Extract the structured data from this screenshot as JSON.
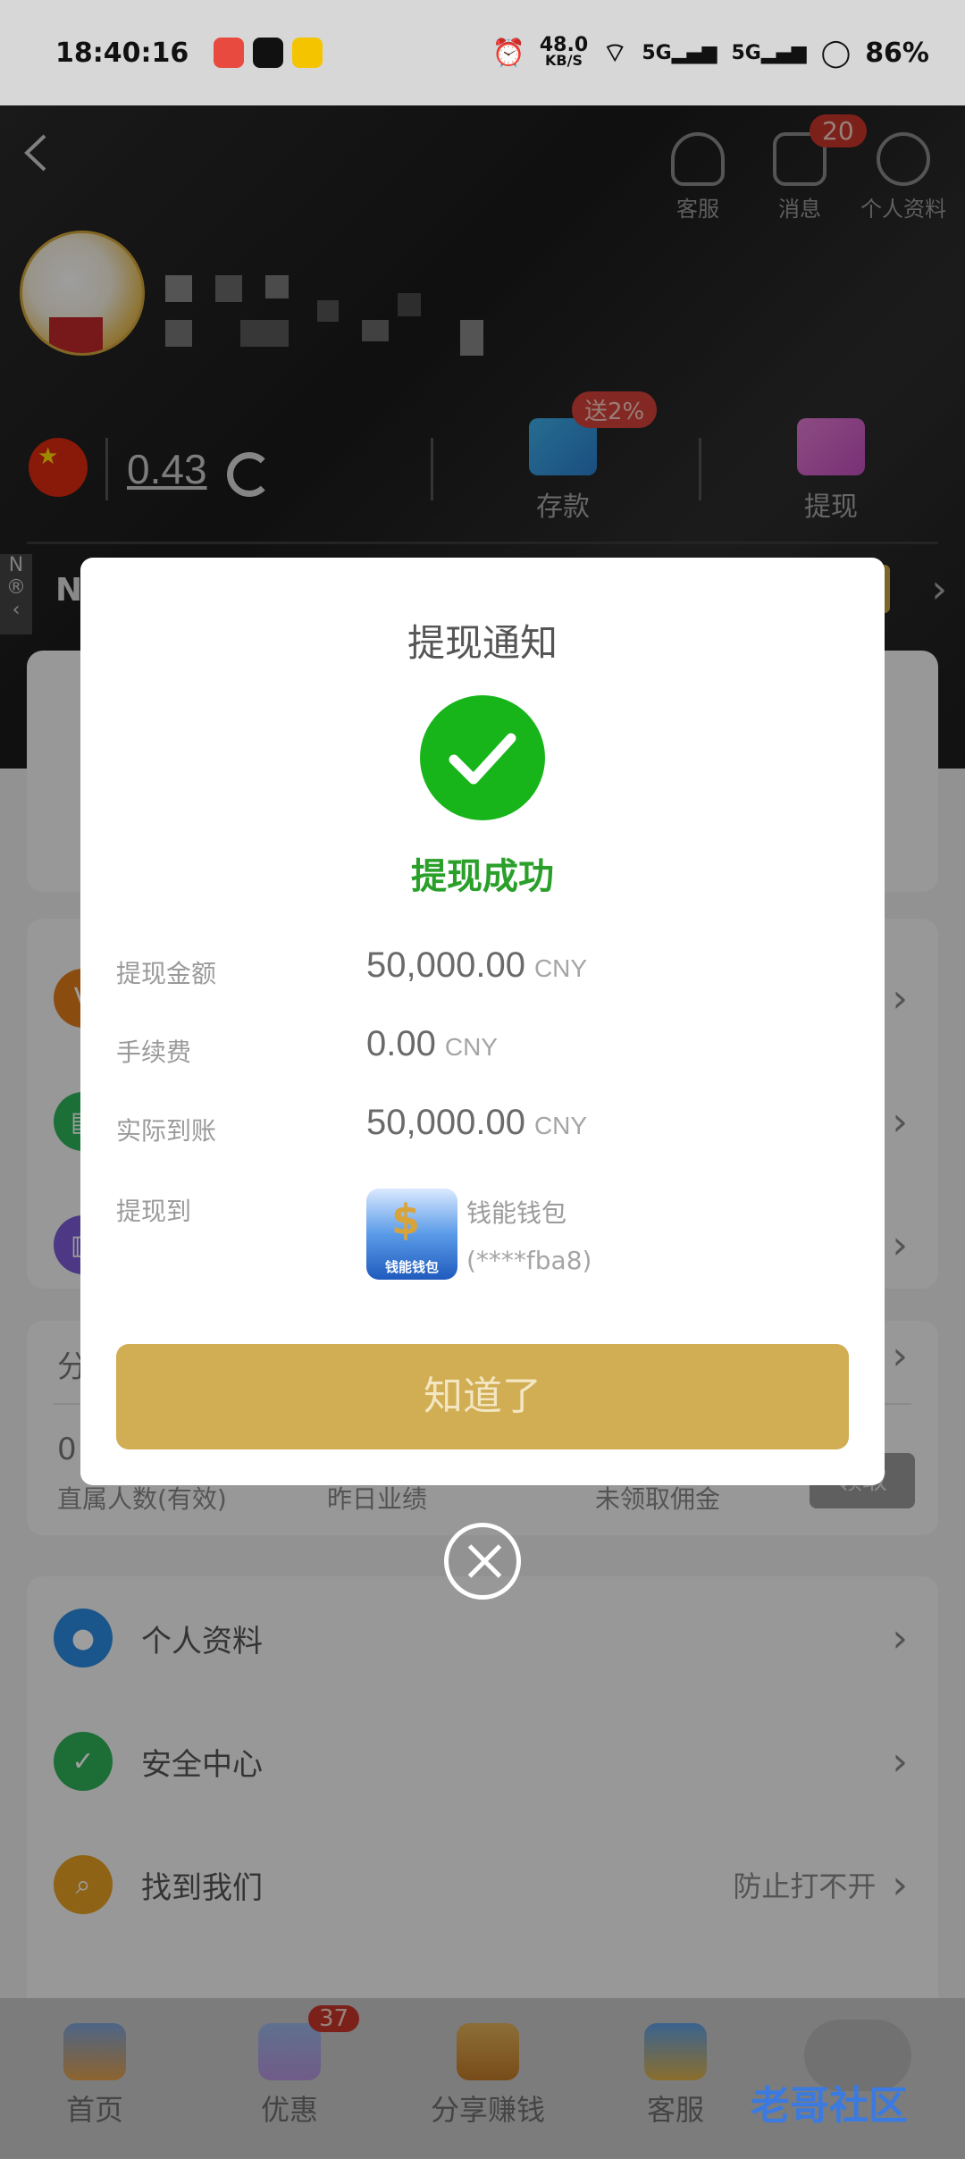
{
  "status_bar": {
    "time": "18:40:16",
    "net_speed": "48.0",
    "net_unit": "KB/S",
    "battery": "86%"
  },
  "header": {
    "icons": [
      {
        "label": "客服"
      },
      {
        "label": "消息",
        "badge": "20"
      },
      {
        "label": "个人资料"
      }
    ],
    "balance": "0.43",
    "deposit_label": "存款",
    "deposit_bonus": "送2%",
    "withdraw_label": "提现",
    "notice_letter": "N"
  },
  "background_items": {
    "stats": {
      "direct_members": "直属人数(有效)",
      "yesterday": "昨日业绩",
      "unclaimed": "未领取佣金",
      "claim": "领取",
      "zero": "0",
      "share_prefix": "分"
    },
    "menu": [
      {
        "label": "个人资料"
      },
      {
        "label": "安全中心"
      },
      {
        "label": "找到我们",
        "extra": "防止打不开"
      }
    ]
  },
  "modal": {
    "title": "提现通知",
    "success_text": "提现成功",
    "rows": [
      {
        "key": "提现金额",
        "value": "50,000.00",
        "unit": "CNY"
      },
      {
        "key": "手续费",
        "value": "0.00",
        "unit": "CNY"
      },
      {
        "key": "实际到账",
        "value": "50,000.00",
        "unit": "CNY"
      }
    ],
    "to_label": "提现到",
    "wallet_name": "钱能钱包",
    "wallet_account": "(****fba8)",
    "wallet_logo_caption": "钱能钱包",
    "ok_button": "知道了"
  },
  "tabbar": {
    "tabs": [
      {
        "label": "首页"
      },
      {
        "label": "优惠",
        "badge": "37"
      },
      {
        "label": "分享赚钱"
      },
      {
        "label": "客服"
      }
    ]
  },
  "watermark": "老哥社区",
  "colors": {
    "success_green": "#17b51a",
    "gold_button": "#d1ad53",
    "badge_red": "#c9362b"
  }
}
